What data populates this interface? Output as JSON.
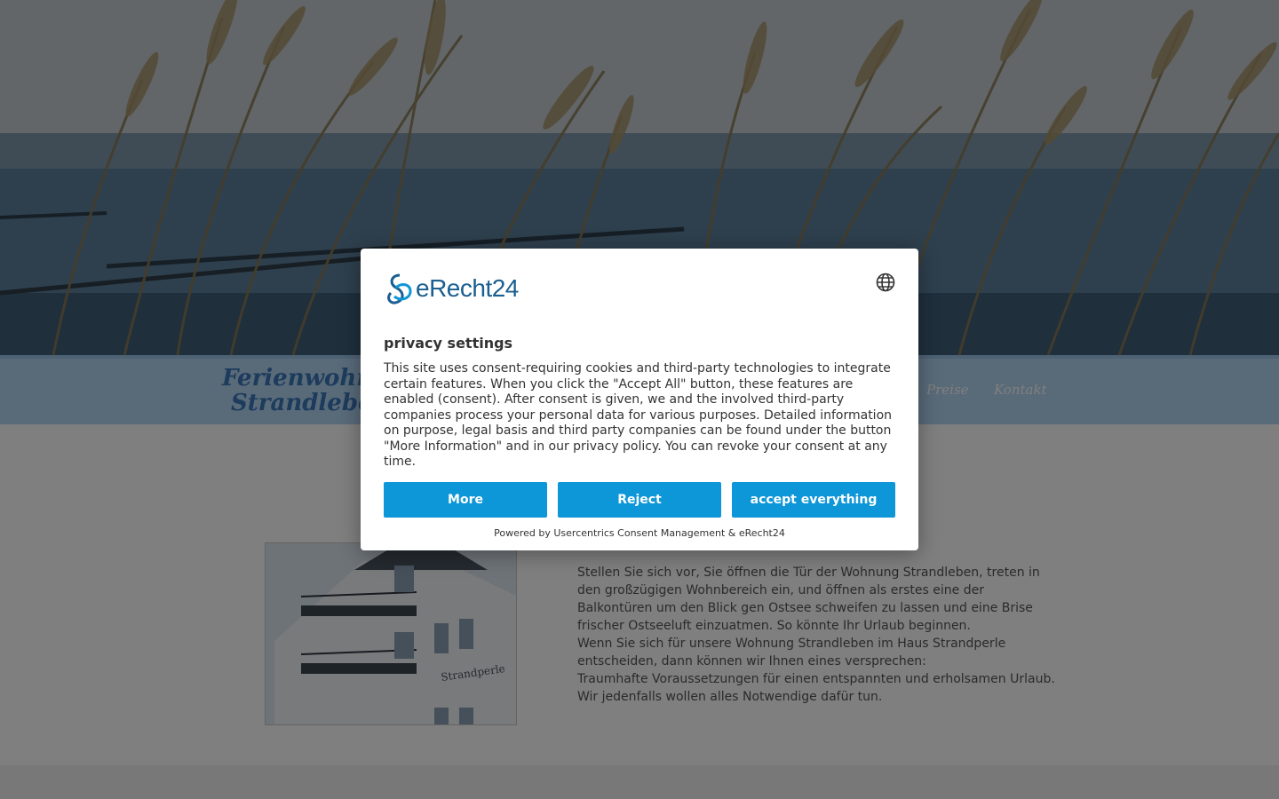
{
  "header": {
    "brand_line1": "Ferienwohnung",
    "brand_line2": "Strandleben",
    "nav": [
      {
        "label": "Preise"
      },
      {
        "label": "Kontakt"
      }
    ]
  },
  "intro": {
    "paragraph1": "Stellen Sie sich vor, Sie öffnen die Tür der Wohnung Strandleben, treten in den großzügigen Wohnbereich ein, und öffnen als erstes eine der Balkontüren um den Blick gen Ostsee schweifen zu lassen und eine Brise frischer Ostseeluft einzuatmen. So könnte Ihr Urlaub beginnen.",
    "paragraph2": "Wenn Sie sich für unsere Wohnung Strandleben im Haus Strandperle entscheiden, dann können wir Ihnen eines versprechen:",
    "paragraph3": "Traumhafte Voraussetzungen für einen entspannten und erholsamen Urlaub. Wir jedenfalls wollen alles Notwendige dafür tun.",
    "house_sign": "Strandperle"
  },
  "consent": {
    "logo_text": "eRecht24",
    "title": "privacy settings",
    "description": "This site uses consent-requiring cookies and third-party technologies to integrate certain features. When you click the \"Accept All\" button, these features are enabled (consent). After consent is given, we and the involved third-party companies process your personal data for various purposes. Detailed information on purpose, legal basis and third party companies can be found under the button \"More Information\" and in our privacy policy. You can revoke your consent at any time.",
    "buttons": {
      "more": "More",
      "reject": "Reject",
      "accept": "accept everything"
    },
    "powered_by": "Powered by Usercentrics Consent Management & eRecht24",
    "language_icon": "globe-icon",
    "accent_color": "#0d96d8"
  }
}
